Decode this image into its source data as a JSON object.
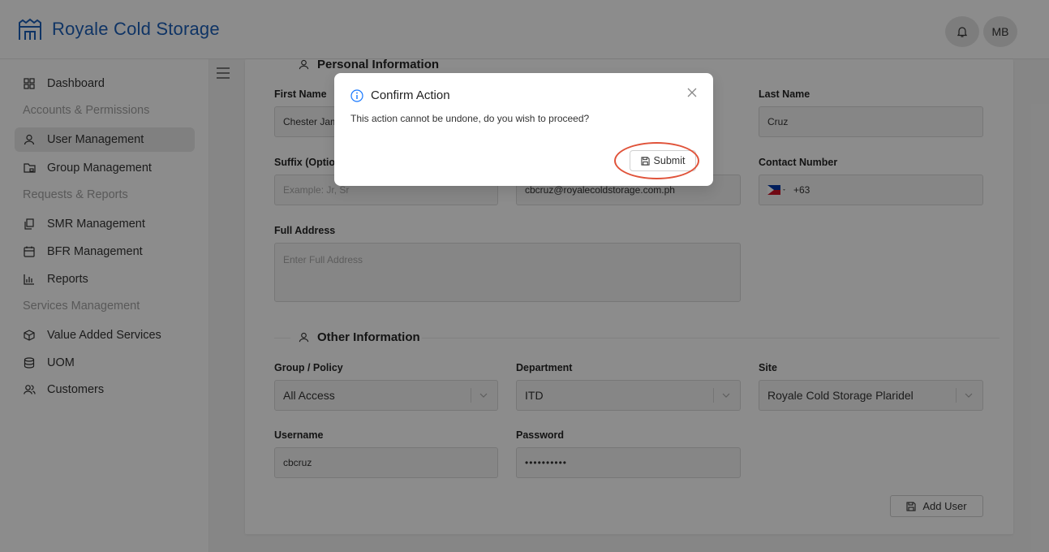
{
  "app": {
    "title": "Royale Cold Storage",
    "brand_color": "#1d5fb8",
    "avatar_initials": "MB"
  },
  "sidebar": {
    "items": [
      {
        "label": "Dashboard",
        "icon": "dashboard-icon"
      },
      {
        "group": "Accounts & Permissions"
      },
      {
        "label": "User Management",
        "icon": "user-icon",
        "active": true
      },
      {
        "label": "Group Management",
        "icon": "folder-lock-icon"
      },
      {
        "group": "Requests & Reports"
      },
      {
        "label": "SMR Management",
        "icon": "copy-icon"
      },
      {
        "label": "BFR Management",
        "icon": "calendar-icon"
      },
      {
        "label": "Reports",
        "icon": "bar-chart-icon"
      },
      {
        "group": "Services Management"
      },
      {
        "label": "Value Added Services",
        "icon": "cube-icon"
      },
      {
        "label": "UOM",
        "icon": "database-icon"
      },
      {
        "label": "Customers",
        "icon": "users-icon"
      }
    ]
  },
  "form": {
    "personal_title": "Personal Information",
    "first_name_label": "First Name",
    "first_name_value": "Chester James",
    "last_name_label": "Last Name",
    "last_name_value": "Cruz",
    "suffix_label": "Suffix (Optional)",
    "suffix_placeholder": "Example: Jr, Sr",
    "email_value": "cbcruz@royalecoldstorage.com.ph",
    "contact_label": "Contact Number",
    "contact_value": "+63",
    "address_label": "Full Address",
    "address_placeholder": "Enter Full Address",
    "other_title": "Other Information",
    "group_label": "Group / Policy",
    "group_value": "All Access",
    "department_label": "Department",
    "department_value": "ITD",
    "site_label": "Site",
    "site_value": "Royale Cold Storage Plaridel",
    "username_label": "Username",
    "username_value": "cbcruz",
    "password_label": "Password",
    "password_value": "••••••••••",
    "add_user_label": "Add User"
  },
  "modal": {
    "title": "Confirm Action",
    "message": "This action cannot be undone, do you wish to proceed?",
    "submit_label": "Submit",
    "highlight_color": "#e0533a"
  }
}
